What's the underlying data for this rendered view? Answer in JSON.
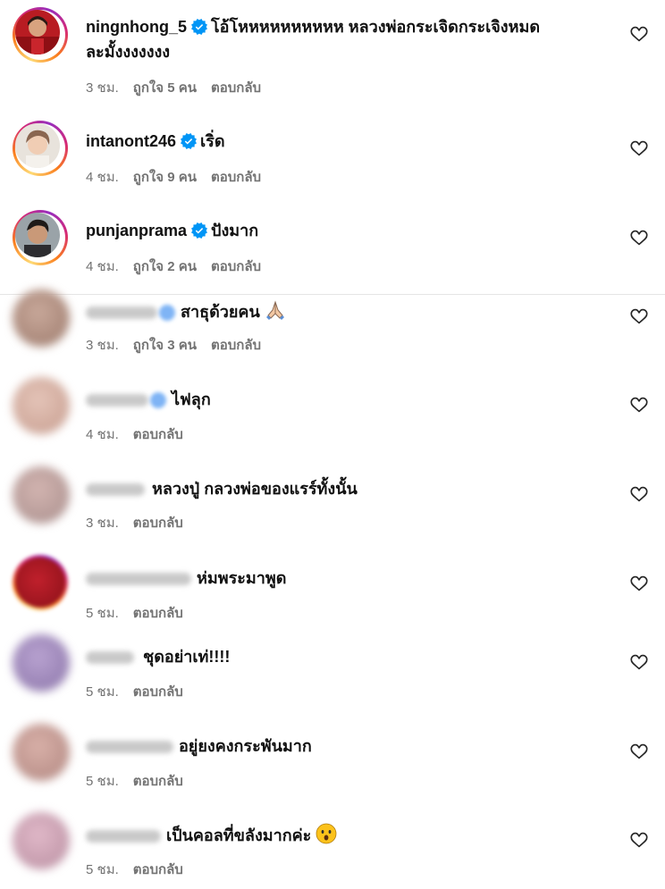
{
  "comments": [
    {
      "username": "ningnhong_5",
      "text_line1": "โอ้โหหหหหหหหหห หลวงพ่อกระเจิดกระเจิงหมด",
      "text_line2": "ละมั้งงงงงงง",
      "time": "3 ชม.",
      "likes": "ถูกใจ 5 คน",
      "reply": "ตอบกลับ"
    },
    {
      "username": "intanont246",
      "text_line1": "เริ่ด",
      "time": "4 ชม.",
      "likes": "ถูกใจ 9 คน",
      "reply": "ตอบกลับ"
    },
    {
      "username": "punjanprama",
      "text_line1": "ปังมาก",
      "time": "4 ชม.",
      "likes": "ถูกใจ 2 คน",
      "reply": "ตอบกลับ"
    },
    {
      "text_line1": "สาธุด้วยคน",
      "time": "3 ชม.",
      "likes": "ถูกใจ 3 คน",
      "reply": "ตอบกลับ"
    },
    {
      "text_line1": "ไฟลุก",
      "time": "4 ชม.",
      "reply": "ตอบกลับ"
    },
    {
      "text_line1": "หลวงปู่ กลวงพ่อของแรร์ทั้งนั้น",
      "time": "3 ชม.",
      "reply": "ตอบกลับ"
    },
    {
      "text_line1": "ห่มพระมาพูด",
      "time": "5 ชม.",
      "reply": "ตอบกลับ"
    },
    {
      "text_line1": "ชุดอย่าเท่!!!!",
      "time": "5 ชม.",
      "reply": "ตอบกลับ"
    },
    {
      "text_line1": "อยู่ยงคงกระพันมาก",
      "time": "5 ชม.",
      "reply": "ตอบกลับ"
    },
    {
      "text_line1": "เป็นคอลที่ขลังมากค่ะ",
      "time": "5 ชม.",
      "reply": "ตอบกลับ"
    }
  ],
  "colors": {
    "verified": "#0095f6",
    "meta_text": "#737373",
    "story_ring": "#d62976"
  },
  "icons": [
    "verified-badge-icon",
    "heart-icon",
    "folded-hands-emoji",
    "astonished-face-emoji"
  ]
}
